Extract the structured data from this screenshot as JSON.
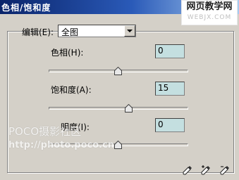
{
  "window": {
    "title": "色相/饱和度"
  },
  "site_logo": {
    "line1": "网页教学网",
    "line2": "WEBJX.COM"
  },
  "edit": {
    "label": "编辑(E):",
    "value": "全图"
  },
  "sliders": {
    "hue": {
      "label": "色相(H):",
      "value": "0",
      "level": 0.5
    },
    "saturation": {
      "label": "饱和度(A):",
      "value": "15",
      "level": 0.575
    },
    "lightness": {
      "label": "明度(I):",
      "value": "0",
      "level": 0.5
    }
  },
  "watermark": {
    "line1": "POCO摄影社区",
    "line2": "http://photo.poco.cn"
  },
  "tools": [
    "eyedropper-icon",
    "eyedropper-plus-icon",
    "eyedropper-minus-icon"
  ]
}
